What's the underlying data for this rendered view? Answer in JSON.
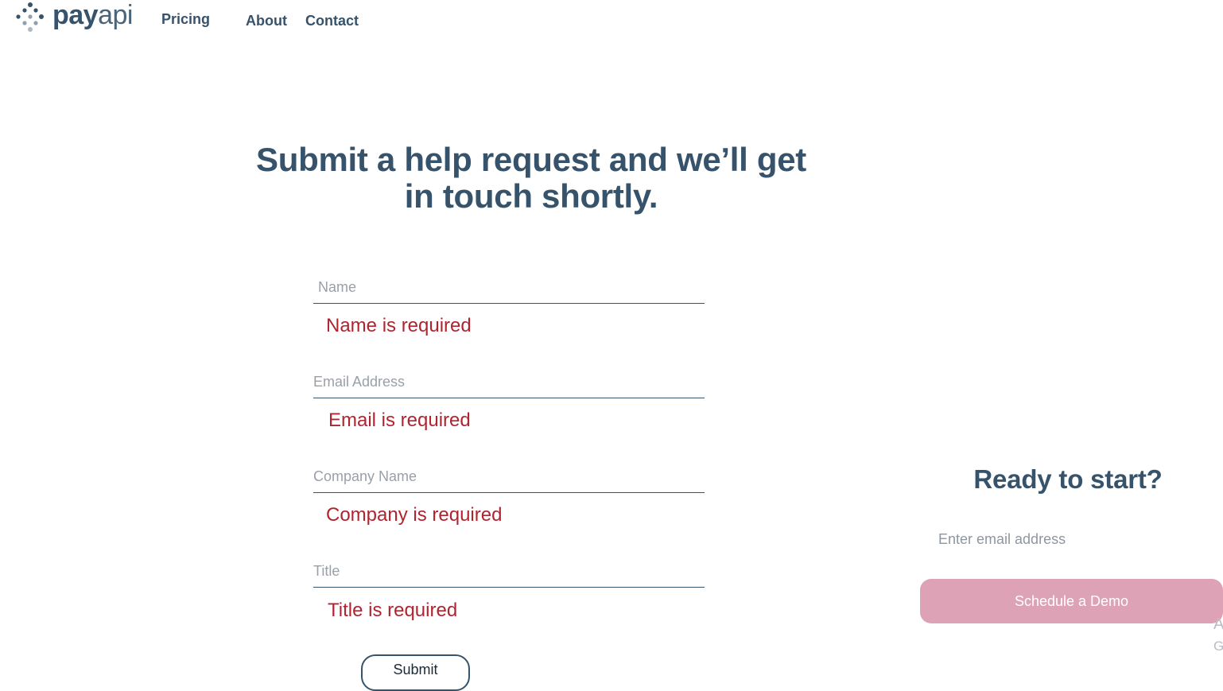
{
  "brand": {
    "logo_icon": "dot-grid-logo-icon",
    "name_bold": "pay",
    "name_light": "api",
    "colors": {
      "primary": "#36536b",
      "error": "#b0242f",
      "cta": "#dea2b6",
      "placeholder": "#9aa0a8"
    }
  },
  "nav": {
    "pricing": "Pricing",
    "about": "About",
    "contact": "Contact"
  },
  "headline": "Submit a help request and we’ll get in touch shortly.",
  "form": {
    "name": {
      "placeholder": "Name",
      "value": "",
      "error": "Name is required"
    },
    "email": {
      "placeholder": "Email Address",
      "value": "",
      "error": "Email is required"
    },
    "company": {
      "placeholder": "Company Name",
      "value": "",
      "error": "Company is required"
    },
    "title": {
      "placeholder": "Title",
      "value": "",
      "error": "Title is required"
    },
    "submit_label": "Submit"
  },
  "cta": {
    "title": "Ready to start?",
    "email_placeholder": "Enter email address",
    "button_label": "Schedule a Demo",
    "edge_chars": [
      "A",
      "G"
    ]
  }
}
